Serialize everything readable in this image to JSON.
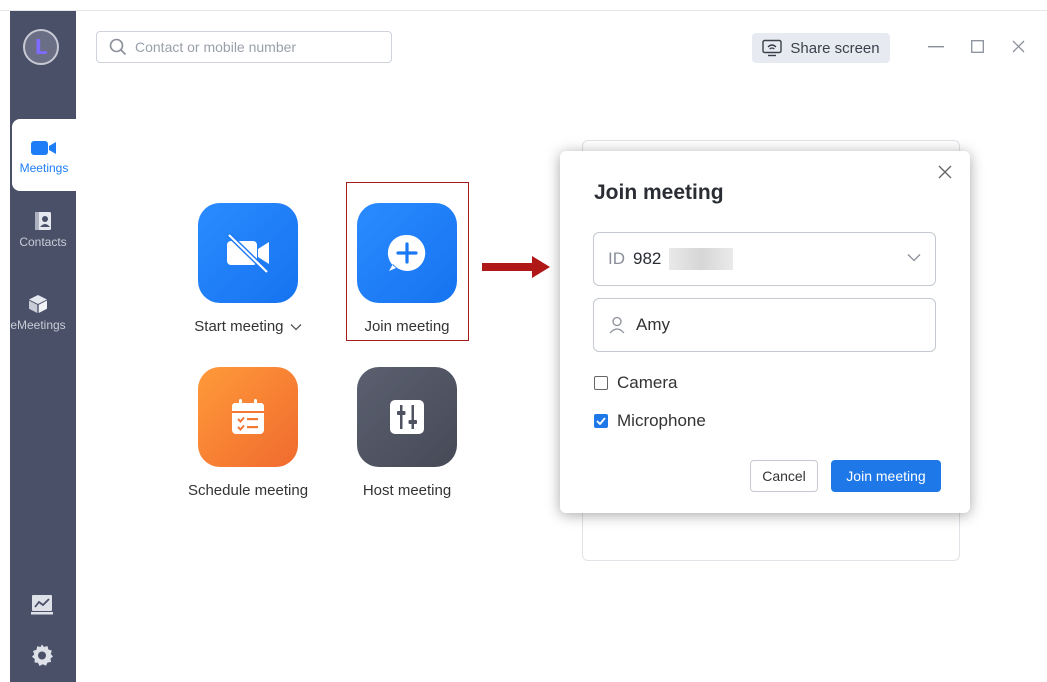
{
  "search": {
    "placeholder": "Contact or mobile number"
  },
  "header": {
    "share_screen_label": "Share screen"
  },
  "avatar": {
    "letter": "L"
  },
  "sidebar": {
    "items": [
      {
        "label": "Meetings",
        "icon": "video-camera-icon",
        "active": true
      },
      {
        "label": "Contacts",
        "icon": "contacts-book-icon",
        "active": false
      },
      {
        "label": "eMeetings",
        "icon": "cube-icon",
        "active": false
      }
    ],
    "bottom_icons": [
      "presentation-chart-icon",
      "settings-gear-icon"
    ]
  },
  "tiles": {
    "start_meeting": {
      "label": "Start meeting",
      "icon": "video-off-icon",
      "color": "#1f7ef7"
    },
    "join_meeting": {
      "label": "Join meeting",
      "icon": "plus-bubble-icon",
      "color": "#1f7ef7"
    },
    "schedule_meeting": {
      "label": "Schedule meeting",
      "icon": "calendar-icon",
      "color": "#f47a33"
    },
    "host_meeting": {
      "label": "Host meeting",
      "icon": "sliders-icon",
      "color": "#4f5361"
    }
  },
  "dialog": {
    "title": "Join meeting",
    "id_prefix": "ID",
    "id_value": "982",
    "name_value": "Amy",
    "camera_label": "Camera",
    "camera_checked": false,
    "microphone_label": "Microphone",
    "microphone_checked": true,
    "cancel_label": "Cancel",
    "join_label": "Join meeting"
  },
  "colors": {
    "accent": "#1f78e8",
    "sidebar": "#4a5068",
    "highlight": "#a31d1d"
  }
}
